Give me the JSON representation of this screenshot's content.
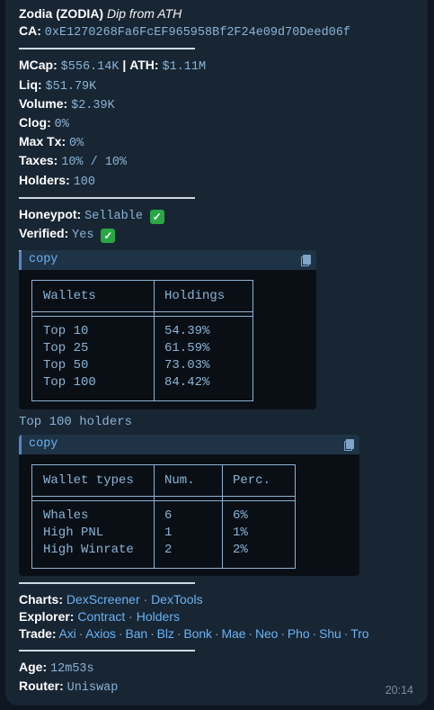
{
  "header": {
    "name": "Zodia (ZODIA)",
    "tag": "Dip from ATH",
    "ca_label": "CA:",
    "ca_value": "0xE1270268Fa6FcEF965958Bf2F24e09d70Deed06f"
  },
  "stats": {
    "mcap_label": "MCap:",
    "mcap_value": "$556.14K",
    "pipe": "|",
    "ath_label": "ATH:",
    "ath_value": "$1.11M",
    "liq_label": "Liq:",
    "liq_value": "$51.79K",
    "volume_label": "Volume:",
    "volume_value": "$2.39K",
    "clog_label": "Clog:",
    "clog_value": "0%",
    "maxtx_label": "Max Tx:",
    "maxtx_value": "0%",
    "taxes_label": "Taxes:",
    "taxes_value": "10% / 10%",
    "holders_label": "Holders:",
    "holders_value": "100"
  },
  "checks": {
    "honeypot_label": "Honeypot:",
    "honeypot_value": "Sellable",
    "verified_label": "Verified:",
    "verified_value": "Yes",
    "check_glyph": "✓"
  },
  "code_label": "copy",
  "holdings_table": {
    "headers": [
      "Wallets",
      "Holdings"
    ],
    "rows": [
      [
        "Top 10",
        "54.39%"
      ],
      [
        "Top 25",
        "61.59%"
      ],
      [
        "Top 50",
        "73.03%"
      ],
      [
        "Top 100",
        "84.42%"
      ]
    ]
  },
  "top_holders_link": "Top 100 holders",
  "wallet_table": {
    "headers": [
      "Wallet types",
      "Num.",
      "Perc."
    ],
    "rows": [
      [
        "Whales",
        "6",
        "6%"
      ],
      [
        "High PNL",
        "1",
        "1%"
      ],
      [
        "High Winrate",
        "2",
        "2%"
      ]
    ]
  },
  "links": {
    "charts_label": "Charts:",
    "charts": [
      "DexScreener",
      "DexTools"
    ],
    "explorer_label": "Explorer:",
    "explorer": [
      "Contract",
      "Holders"
    ],
    "trade_label": "Trade:",
    "trade": [
      "Axi",
      "Axios",
      "Ban",
      "Blz",
      "Bonk",
      "Mae",
      "Neo",
      "Pho",
      "Shu",
      "Tro"
    ],
    "dot": "·"
  },
  "footer": {
    "age_label": "Age:",
    "age_value": "12m53s",
    "router_label": "Router:",
    "router_value": "Uniswap",
    "time": "20:14"
  }
}
